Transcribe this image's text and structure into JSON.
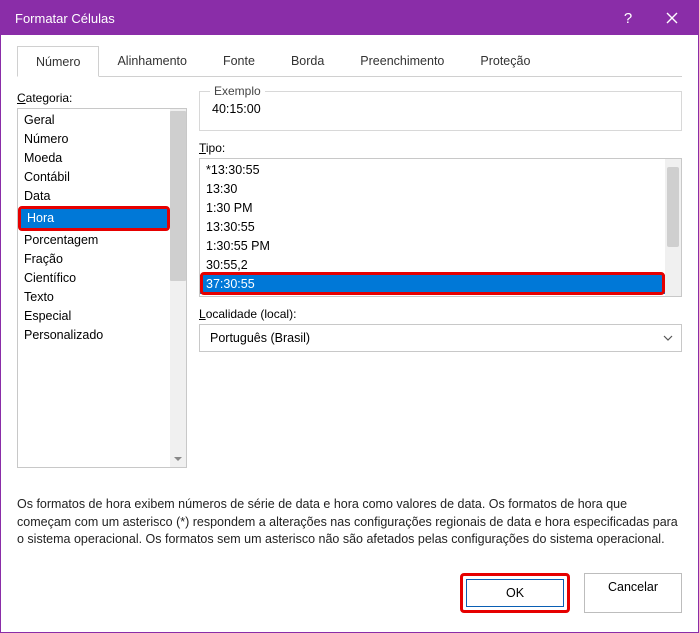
{
  "title": "Formatar Células",
  "tabs": {
    "numero": "Número",
    "alinhamento": "Alinhamento",
    "fonte": "Fonte",
    "borda": "Borda",
    "preenchimento": "Preenchimento",
    "protecao": "Proteção"
  },
  "categoria": {
    "label_pre": "C",
    "label_post": "ategoria:",
    "items": [
      "Geral",
      "Número",
      "Moeda",
      "Contábil",
      "Data",
      "Hora",
      "Porcentagem",
      "Fração",
      "Científico",
      "Texto",
      "Especial",
      "Personalizado"
    ],
    "selected": "Hora"
  },
  "exemplo": {
    "legend": "Exemplo",
    "value": "40:15:00"
  },
  "tipo": {
    "label_pre": "T",
    "label_post": "ipo:",
    "items": [
      "*13:30:55",
      "13:30",
      "1:30 PM",
      "13:30:55",
      "1:30:55 PM",
      "30:55,2",
      "37:30:55"
    ],
    "selected": "37:30:55"
  },
  "localidade": {
    "label_pre": "L",
    "label_post": "ocalidade (local):",
    "value": "Português (Brasil)"
  },
  "description": "Os formatos de hora exibem números de série de data e hora como valores de data. Os formatos de hora que começam com um asterisco (*) respondem a alterações nas configurações regionais de data e hora especificadas para o sistema operacional. Os formatos sem um asterisco não são afetados pelas configurações do sistema operacional.",
  "buttons": {
    "ok": "OK",
    "cancel": "Cancelar"
  }
}
